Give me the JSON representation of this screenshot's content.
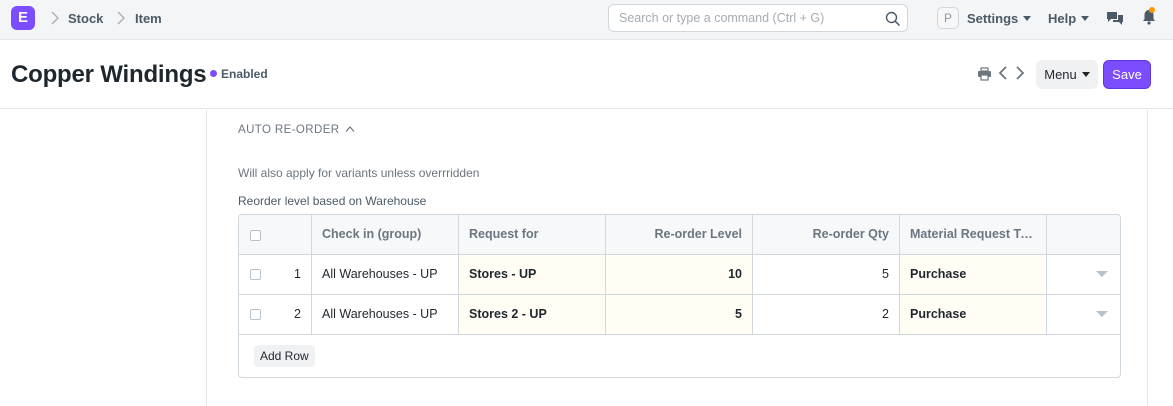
{
  "navbar": {
    "logo": "E",
    "breadcrumbs": [
      "Stock",
      "Item"
    ],
    "search_placeholder": "Search or type a command (Ctrl + G)",
    "avatar_initial": "P",
    "settings_label": "Settings",
    "help_label": "Help"
  },
  "page": {
    "title": "Copper Windings",
    "status": "Enabled",
    "menu_label": "Menu",
    "save_label": "Save"
  },
  "section": {
    "title": "AUTO RE-ORDER",
    "help_text": "Will also apply for variants unless overrridden",
    "field_label": "Reorder level based on Warehouse"
  },
  "table": {
    "headers": [
      "Check in (group)",
      "Request for",
      "Re-order Level",
      "Re-order Qty",
      "Material Request Ty..."
    ],
    "rows": [
      {
        "idx": "1",
        "check_in": "All Warehouses - UP",
        "request_for": "Stores - UP",
        "reorder_level": "10",
        "reorder_qty": "5",
        "request_type": "Purchase"
      },
      {
        "idx": "2",
        "check_in": "All Warehouses - UP",
        "request_for": "Stores 2 - UP",
        "reorder_level": "5",
        "reorder_qty": "2",
        "request_type": "Purchase"
      }
    ],
    "add_row_label": "Add Row"
  },
  "colors": {
    "accent": "#7c4dff",
    "notification": "#ff9800",
    "editable_cell": "#fffdf4"
  }
}
